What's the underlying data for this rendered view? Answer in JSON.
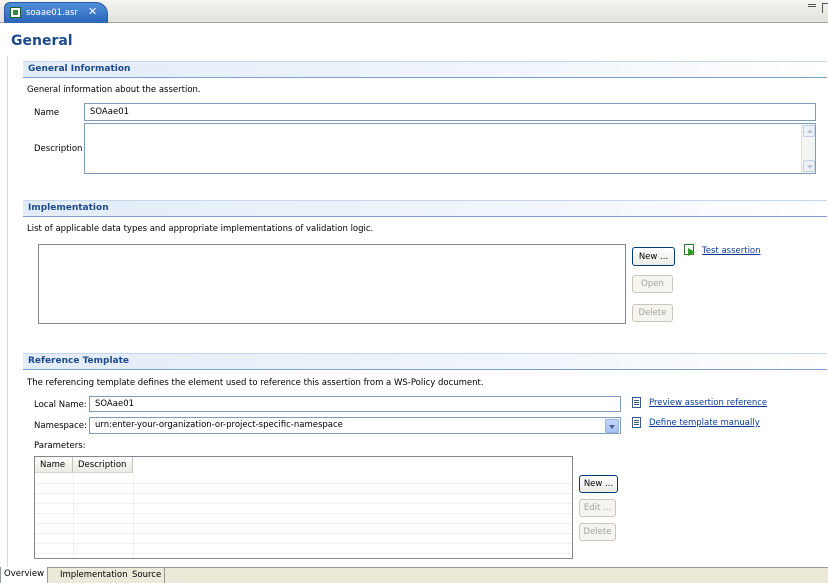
{
  "editor": {
    "tab_label": "soaae01.asr",
    "page_title": "General"
  },
  "general_info": {
    "header": "General Information",
    "description_text": "General information about the assertion.",
    "name_label": "Name",
    "name_value": "SOAae01",
    "description_label": "Description",
    "description_value": ""
  },
  "implementation": {
    "header": "Implementation",
    "description_text": "List of applicable data types and appropriate implementations of validation logic.",
    "buttons": {
      "new": "New ...",
      "open": "Open",
      "delete": "Delete"
    },
    "test_link": "Test assertion"
  },
  "reference_template": {
    "header": "Reference Template",
    "description_text": "The referencing template defines the element used to reference this assertion from a WS-Policy document.",
    "local_name_label": "Local Name:",
    "local_name_value": "SOAae01",
    "namespace_label": "Namespace:",
    "namespace_value": "urn:enter-your-organization-or-project-specific-namespace",
    "preview_link": "Preview assertion reference",
    "define_link": "Define template manually",
    "parameters_label": "Parameters:",
    "columns": [
      "Name",
      "Description"
    ],
    "rows": [],
    "buttons": {
      "new": "New ...",
      "edit": "Edit ...",
      "delete": "Delete"
    }
  },
  "bottom_tabs": [
    {
      "label": "Overview",
      "active": true
    },
    {
      "label": "Implementation",
      "active": false
    },
    {
      "label": "Source",
      "active": false
    }
  ],
  "icons": {
    "file": "asr-file-icon",
    "close": "close-icon",
    "run": "run-test-icon",
    "document": "document-icon",
    "dropdown": "chevron-down-icon"
  },
  "colors": {
    "accent": "#1e4a8c",
    "tab_active": "#3a75c9",
    "link": "#0b3c97"
  }
}
